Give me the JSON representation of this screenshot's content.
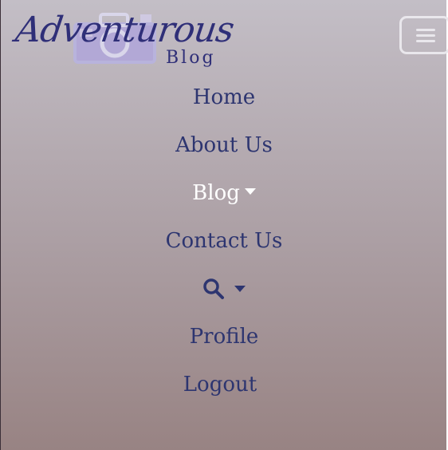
{
  "brand": {
    "name": "Adventurous",
    "subtitle": "Blog"
  },
  "nav": {
    "items": [
      {
        "label": "Home"
      },
      {
        "label": "About Us"
      },
      {
        "label": "Blog"
      },
      {
        "label": "Contact Us"
      },
      {
        "label": ""
      },
      {
        "label": "Profile"
      },
      {
        "label": "Logout"
      }
    ]
  },
  "icons": {
    "menu": "hamburger-icon",
    "search": "search-icon",
    "dropdown": "caret-down-icon",
    "camera": "camera-icon"
  },
  "colors": {
    "nav_text": "#2d3570",
    "active_text": "#ffffff",
    "logo": "#2f2f78",
    "toggler": "#e9e7ec"
  }
}
